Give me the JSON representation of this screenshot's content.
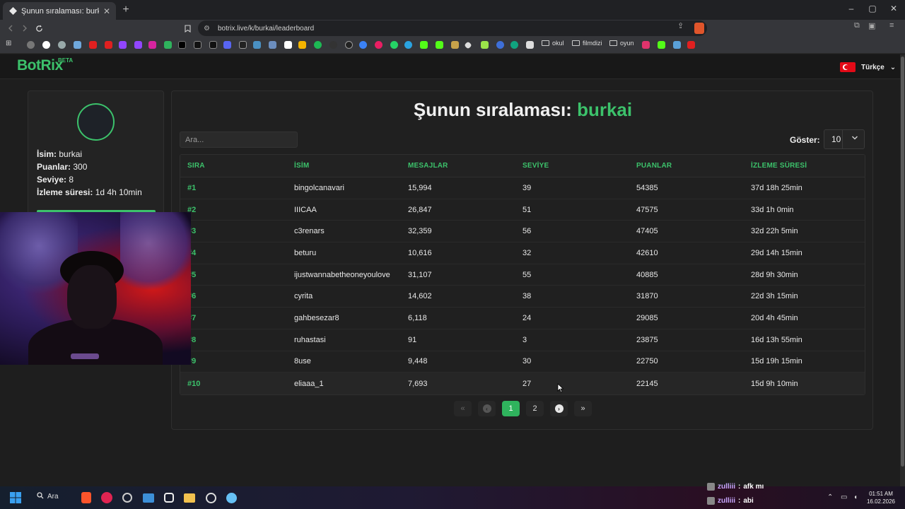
{
  "browser": {
    "tab_title": "Şunun sıralaması: burkai | Yayınc",
    "new_tab": "+",
    "url": "botrix.live/k/burkai/leaderboard",
    "window_controls": [
      "–",
      "▢",
      "✕"
    ],
    "bookmark_folders": [
      "okul",
      "filmdizi",
      "oyun"
    ]
  },
  "site": {
    "logo": "BotRix",
    "logo_badge": "BETA",
    "language": "Türkçe"
  },
  "profile": {
    "name_label": "İsim:",
    "name": "burkai",
    "points_label": "Puanlar:",
    "points": "300",
    "level_label": "Seviye:",
    "level": "8",
    "watch_label": "İzleme süresi:",
    "watch_time": "1d 4h 10min",
    "progress": 1.0
  },
  "leaderboard": {
    "heading_prefix": "Şunun sıralaması:",
    "heading_user": "burkai",
    "search_placeholder": "Ara...",
    "show_label": "Göster:",
    "show_value": "10",
    "columns": [
      "SIRA",
      "İSİM",
      "MESAJLAR",
      "SEVİYE",
      "PUANLAR",
      "İZLEME SÜRESİ"
    ],
    "rows": [
      {
        "rank": "#1",
        "name": "bingolcanavari",
        "messages": "15,994",
        "level": "39",
        "points": "54385",
        "watch": "37d 18h 25min"
      },
      {
        "rank": "#2",
        "name": "IIICAA",
        "messages": "26,847",
        "level": "51",
        "points": "47575",
        "watch": "33d 1h 0min"
      },
      {
        "rank": "#3",
        "name": "c3renars",
        "messages": "32,359",
        "level": "56",
        "points": "47405",
        "watch": "32d 22h 5min"
      },
      {
        "rank": "#4",
        "name": "beturu",
        "messages": "10,616",
        "level": "32",
        "points": "42610",
        "watch": "29d 14h 15min"
      },
      {
        "rank": "#5",
        "name": "ijustwannabetheoneyoulove",
        "messages": "31,107",
        "level": "55",
        "points": "40885",
        "watch": "28d 9h 30min"
      },
      {
        "rank": "#6",
        "name": "cyrita",
        "messages": "14,602",
        "level": "38",
        "points": "31870",
        "watch": "22d 3h 15min"
      },
      {
        "rank": "#7",
        "name": "gahbesezar8",
        "messages": "6,118",
        "level": "24",
        "points": "29085",
        "watch": "20d 4h 45min"
      },
      {
        "rank": "#8",
        "name": "ruhastasi",
        "messages": "91",
        "level": "3",
        "points": "23875",
        "watch": "16d 13h 55min"
      },
      {
        "rank": "#9",
        "name": "8use",
        "messages": "9,448",
        "level": "30",
        "points": "22750",
        "watch": "15d 19h 15min"
      },
      {
        "rank": "#10",
        "name": "eliaaa_1",
        "messages": "7,693",
        "level": "27",
        "points": "22145",
        "watch": "15d 9h 10min"
      }
    ],
    "pagination": {
      "first": "«",
      "prev": "‹",
      "pages": [
        "1",
        "2"
      ],
      "next": "›",
      "last": "»"
    }
  },
  "taskbar": {
    "search_label": "Ara",
    "chat": [
      {
        "user": "zulliii",
        "message": "afk mı"
      },
      {
        "user": "zulliii",
        "message": "abi"
      }
    ],
    "time": "01:51 AM",
    "date": "16.02.2026"
  },
  "colors": {
    "accent": "#3cc26b",
    "background": "#1e1e1e",
    "card": "#202020"
  }
}
